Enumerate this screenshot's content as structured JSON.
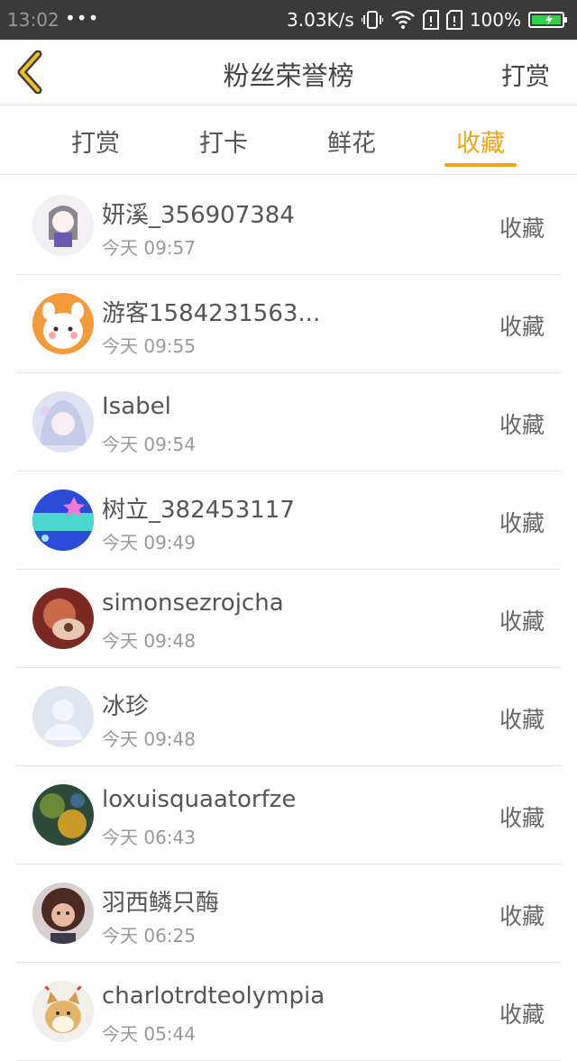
{
  "status": {
    "time": "13:02",
    "dots": "•••",
    "speed": "3.03K/s",
    "battery": "100%"
  },
  "header": {
    "title": "粉丝荣誉榜",
    "action": "打赏"
  },
  "tabs": [
    {
      "label": "打赏"
    },
    {
      "label": "打卡"
    },
    {
      "label": "鲜花"
    },
    {
      "label": "收藏"
    }
  ],
  "active_tab": "收藏",
  "list": [
    {
      "name": "妍溪_356907384",
      "time": "今天 09:57",
      "action": "收藏"
    },
    {
      "name": "游客1584231563...",
      "time": "今天 09:55",
      "action": "收藏"
    },
    {
      "name": "Isabel",
      "time": "今天 09:54",
      "action": "收藏"
    },
    {
      "name": "树立_382453117",
      "time": "今天 09:49",
      "action": "收藏"
    },
    {
      "name": "simonsezrojcha",
      "time": "今天 09:48",
      "action": "收藏"
    },
    {
      "name": "冰珍",
      "time": "今天 09:48",
      "action": "收藏"
    },
    {
      "name": "loxuisquaatorfze",
      "time": "今天 06:43",
      "action": "收藏"
    },
    {
      "name": "羽西鳞只酶",
      "time": "今天 06:25",
      "action": "收藏"
    },
    {
      "name": "charlotrdteolympia",
      "time": "今天 05:44",
      "action": "收藏"
    }
  ],
  "colors": {
    "accent": "#f0a41c",
    "status_bar": "#3a3a3a",
    "battery": "#2fd24a"
  }
}
